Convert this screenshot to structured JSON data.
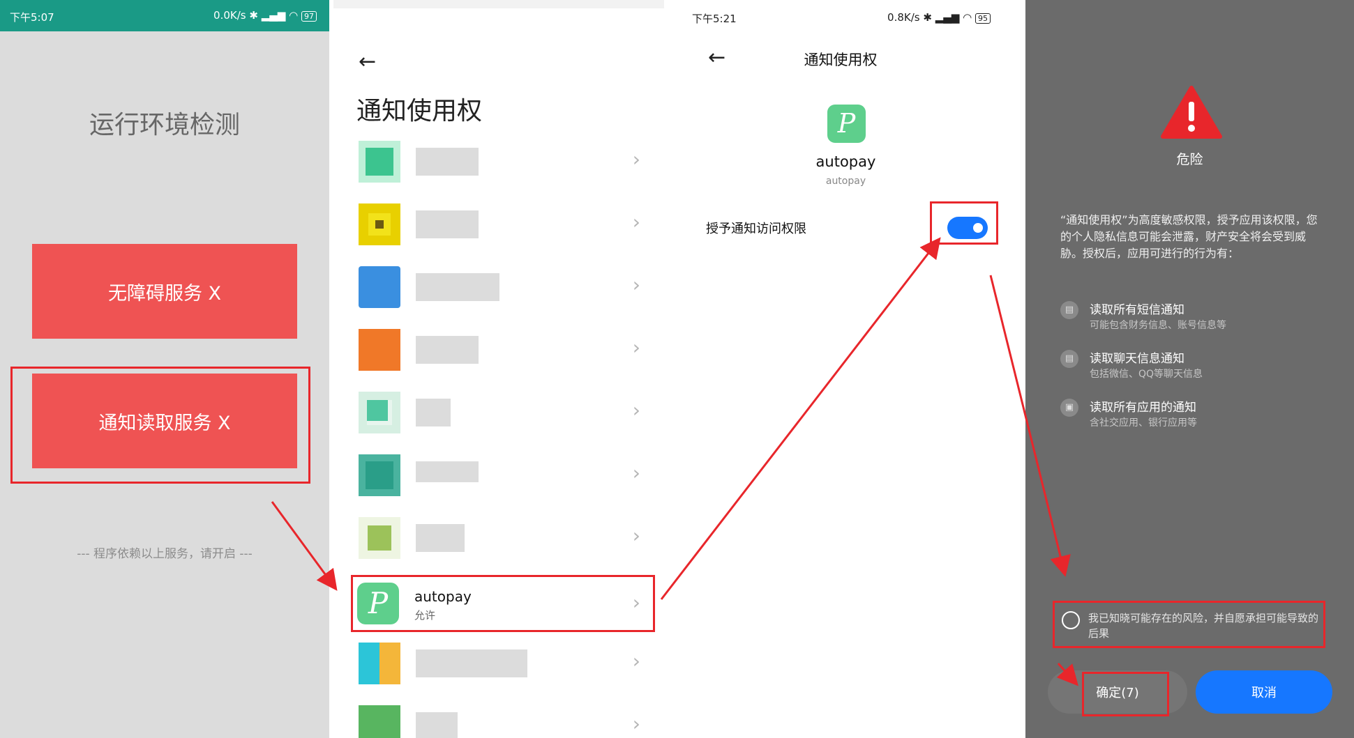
{
  "panel1": {
    "status_time": "下午5:07",
    "status_speed": "0.0K/s",
    "status_battery": "97",
    "title": "运行环境检测",
    "accessibility_button": "无障碍服务 X",
    "notification_button": "通知读取服务 X",
    "hint": "--- 程序依赖以上服务，请开启 ---"
  },
  "panel2": {
    "title": "通知使用权",
    "app_name": "autopay",
    "app_status": "允许"
  },
  "panel3": {
    "status_time": "下午5:21",
    "status_speed": "0.8K/s",
    "status_battery": "95",
    "title": "通知使用权",
    "app_name": "autopay",
    "app_package": "autopay",
    "toggle_label": "授予通知访问权限"
  },
  "panel4": {
    "warning_title": "危险",
    "description": "“通知使用权”为高度敏感权限，授予应用该权限，您的个人隐私信息可能会泄露，财产安全将会受到威胁。授权后，应用可进行的行为有：",
    "permissions": [
      {
        "title": "读取所有短信通知",
        "sub": "可能包含财务信息、账号信息等"
      },
      {
        "title": "读取聊天信息通知",
        "sub": "包括微信、QQ等聊天信息"
      },
      {
        "title": "读取所有应用的通知",
        "sub": "含社交应用、银行应用等"
      }
    ],
    "consent": "我已知晓可能存在的风险，并自愿承担可能导致的后果",
    "confirm_button": "确定(7)",
    "cancel_button": "取消"
  },
  "colors": {
    "status_green": "#1a9a86",
    "button_red": "#ef5353",
    "annotation_red": "#e8262b",
    "toggle_blue": "#1677ff",
    "app_green": "#5ecf8c"
  }
}
